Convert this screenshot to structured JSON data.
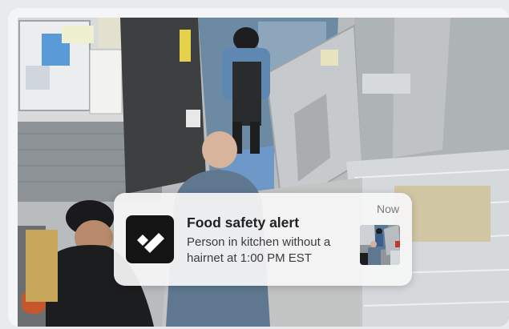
{
  "notification": {
    "icon": "app-logo-icon",
    "title": "Food safety alert",
    "body": "Person in kitchen without a hairnet at 1:00 PM EST",
    "time": "Now",
    "thumbnail": "kitchen-snapshot"
  },
  "colors": {
    "page_background": "#e9eaec",
    "card_background": "#f4f5f6",
    "notification_background": "#f6f6f6",
    "icon_background": "#141414",
    "title_text": "#202124",
    "body_text": "#3b3b3f",
    "time_text": "#7a7a7e"
  }
}
